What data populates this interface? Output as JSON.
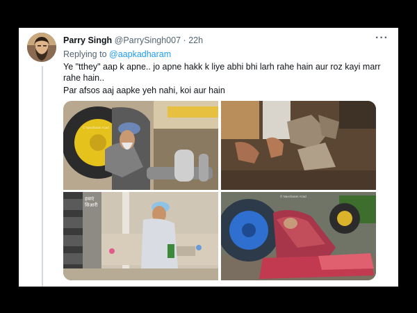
{
  "tweet": {
    "author_name": "Parry Singh",
    "handle": "@ParrySingh007",
    "separator": "·",
    "time": "22h",
    "more_label": "···",
    "reply_prefix": "Replying to",
    "reply_to": "@aapkadharam",
    "text_line1": "Ye \"tthey\" aap k apne.. jo apne hakk k liye abhi bhi larh rahe hain aur roz kayi marr rahe hain..",
    "text_line2": "Par afsos aaj aapke yeh nahi, koi aur hain"
  },
  "media": {
    "watermark": "© Navcharan Azad",
    "wall_text": "हवाएं सिआरी",
    "photo_count": 4
  },
  "colors": {
    "page_background": "#000000",
    "card_background": "#ffffff",
    "link_blue": "#1d9bf0",
    "secondary_text": "#536471",
    "thread_line": "#cfd9de"
  },
  "icons": [
    "more-options-icon"
  ]
}
